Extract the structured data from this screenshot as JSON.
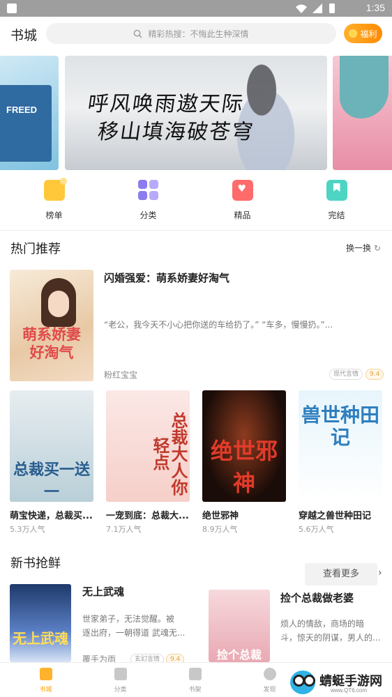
{
  "status_bar": {
    "time": "1:35"
  },
  "header": {
    "title": "书城",
    "search_placeholder": "精彩热搜：不悔此生种深情",
    "welfare_label": "福利"
  },
  "banner": {
    "left_text": "FREED",
    "main_text_line1": "呼风唤雨遨天际",
    "main_text_line2": "移山填海破苍穹"
  },
  "categories": [
    {
      "label": "榜单",
      "icon": "ranking-icon"
    },
    {
      "label": "分类",
      "icon": "category-icon"
    },
    {
      "label": "精品",
      "icon": "boutique-icon"
    },
    {
      "label": "完结",
      "icon": "completed-icon"
    }
  ],
  "hot": {
    "title": "热门推荐",
    "refresh_label": "换一换",
    "featured": {
      "title": "闪婚强爱：萌系娇妻好淘气",
      "description": "“老公，我今天不小心把你送的车给扔了。” “车多，慢慢扔。”...",
      "author": "粉红宝宝",
      "tag": "现代言情",
      "score": "9.4",
      "cover_text": "萌系娇妻好淘气"
    },
    "books": [
      {
        "name": "萌宝快递，总裁买...",
        "popularity": "5.3万人气",
        "cover_text": "总裁买一送一"
      },
      {
        "name": "一宠到底：总裁大...",
        "popularity": "7.1万人气",
        "cover_text": "总裁大人你轻点"
      },
      {
        "name": "绝世邪神",
        "popularity": "8.9万人气",
        "cover_text": "绝世邪神"
      },
      {
        "name": "穿越之兽世种田记",
        "popularity": "5.6万人气",
        "cover_text": "兽世种田记"
      }
    ]
  },
  "new_books": {
    "title": "新书抢鲜",
    "more_label": "查看更多",
    "items": [
      {
        "title": "无上武魂",
        "description_line1": "世家弟子，无法觉醒。被",
        "description_line2": "逐出府，一朝得道 武魂无...",
        "author": "覆手为雨",
        "tag": "玄幻言情",
        "score": "9.4",
        "cover_text": "无上武魂"
      },
      {
        "title": "捡个总裁做老婆",
        "description_line1": "烦人的情敌，商场的暗",
        "description_line2": "斗，惊天的阴谋，男人的...",
        "author": "",
        "cover_text": "捡个总裁"
      }
    ]
  },
  "bottom_nav": [
    {
      "label": "书城",
      "active": true
    },
    {
      "label": "分类",
      "active": false
    },
    {
      "label": "书架",
      "active": false
    },
    {
      "label": "发现",
      "active": false
    }
  ],
  "watermark": {
    "name": "蜻蜓手游网",
    "url": "www.QT6.com"
  },
  "colors": {
    "accent": "#ffa000",
    "score": "#e6a23c",
    "status_bar": "#9e9e9e"
  }
}
